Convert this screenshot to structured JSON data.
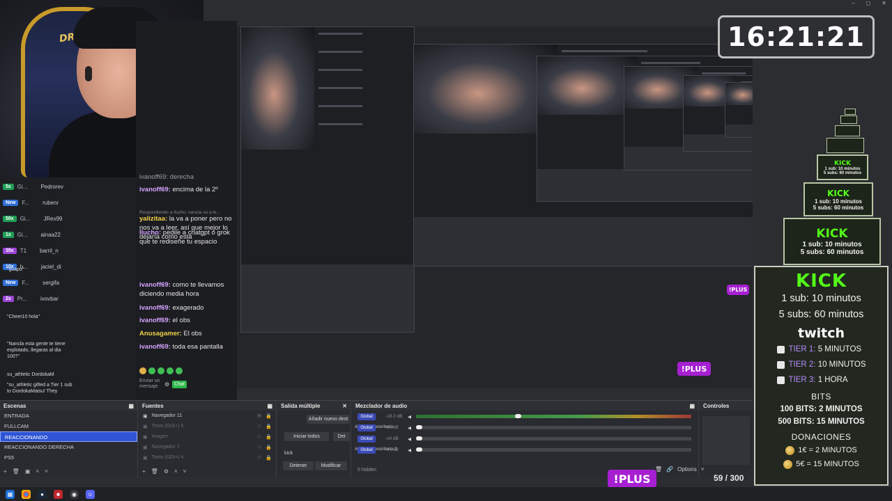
{
  "clock": {
    "time": "16:21:21"
  },
  "cam": {
    "chair_text": "DRIFT"
  },
  "chat_users": [
    {
      "badge": "5x",
      "badge_label": "Gi...",
      "name": "Pedrorev",
      "color": "#1f9d55"
    },
    {
      "badge": "New",
      "badge_label": "F...",
      "name": "rubenr",
      "color": "#2f6fd6"
    },
    {
      "badge": "50x",
      "badge_label": "Gi...",
      "name": "JRex99",
      "color": "#1f9d55"
    },
    {
      "badge": "1x",
      "badge_label": "Gi...",
      "name": "ainaa22",
      "color": "#1f9d55"
    },
    {
      "badge": "35x",
      "badge_label": "T1",
      "name": "barril_n",
      "color": "#9c45d6"
    },
    {
      "badge": "10x",
      "badge_label": "b...",
      "name": "jaciel_di",
      "color": "#2f6fd6"
    },
    {
      "badge": "New",
      "badge_label": "F...",
      "name": "sergifa",
      "color": "#2f6fd6"
    },
    {
      "badge": "2x",
      "badge_label": "Pr...",
      "name": "ivovbar",
      "color": "#9c45d6"
    }
  ],
  "chat_quotes": {
    "guapo": "\"guapo\"",
    "cheer": "\"Cheer10 hola\"",
    "nancla": "\"Nancla esta gente te tiene explotado, llegaras al dia 100?\"",
    "gifted_user": "su_athletic DordokaM",
    "gifted": "\"su_athletic gifted a Tier 1 sub to DordokaMaisu! They"
  },
  "messages": [
    {
      "user": "ivanoff69:",
      "text": " encima de la 2º",
      "cls": "u"
    },
    {
      "user": "yalizitaa:",
      "text": " la va a poner pero no nos va a leer, así que mejor lo dejaría como está",
      "cls": "u2"
    },
    {
      "user": "Ilucho:",
      "text": " pedile a chatgpt o grok que te rediseñe tu espacio",
      "cls": "u"
    },
    {
      "user": "ivanoff69:",
      "text": " como te llevamos diciendo media hora",
      "cls": "u"
    },
    {
      "user": "ivanoff69:",
      "text": " exagerado",
      "cls": "u"
    },
    {
      "user": "ivanoff69:",
      "text": " el obs",
      "cls": "u"
    },
    {
      "user": "Anusagamer:",
      "text": " El obs",
      "cls": "u2"
    },
    {
      "user": "ivanoff69:",
      "text": " toda esa pantalla",
      "cls": "u"
    }
  ],
  "reply_hint": "Respondiendo a Ilucho: nancla va a te...",
  "top_partial": "ivanoff69: derecha",
  "send_button": "Chat",
  "chat_input_placeholder": "Enviar un mensaje",
  "obs": {
    "scenes": {
      "title": "Escenas",
      "items": [
        "ENTRADA",
        "FULLCAM",
        "REACCIONANDO",
        "REACCIONANDO DERECHA",
        "PS5"
      ],
      "selected_index": 2
    },
    "sources": {
      "title": "Fuentes",
      "items": [
        {
          "name": "Navegador 11",
          "dim": false
        },
        {
          "name": "Texto (GDI+) 5",
          "dim": true
        },
        {
          "name": "Imagen",
          "dim": true
        },
        {
          "name": "Navegador 7",
          "dim": true
        },
        {
          "name": "Texto (GDI+) 4",
          "dim": true
        }
      ]
    },
    "multi_output": {
      "title": "Salida múltiple",
      "add_button": "Añadir nuevo dest",
      "start_all": "Iniciar todos",
      "dest_short": "Det",
      "target": "kick",
      "stop": "Detener",
      "modify": "Modificar"
    },
    "mixer": {
      "title": "Mezclador de audio",
      "global_label": "Global",
      "tracks": [
        {
          "label": "Audio del escritorio",
          "db": "-18.0 dB",
          "level": 0.66,
          "knob": 0.36
        },
        {
          "label": "",
          "db": "-inf dB",
          "level": 0.0,
          "knob": 0.0
        },
        {
          "label": "Audio del escritorio 2",
          "db": "-inf dB",
          "level": 0.0,
          "knob": 0.0
        },
        {
          "label": "",
          "db": "-inf dB",
          "level": 0.0,
          "knob": 0.0
        }
      ],
      "hidden": "0 hidden"
    },
    "controls": {
      "title": "Controles"
    },
    "options": "Options"
  },
  "kick_mini": [
    {
      "sub1": "1 sub: 10 minutos",
      "sub5": "5 subs: 60 minutos"
    },
    {
      "sub1": "1 sub: 10 minutos",
      "sub5": "5 subs: 60 minutos"
    },
    {
      "sub1": "1 sub: 10 minutos",
      "sub5": "5 subs: 60 minutos"
    }
  ],
  "panel": {
    "kick_logo": "KICK",
    "kick_sub1": "1 sub: 10 minutos",
    "kick_sub5": "5 subs: 60 minutos",
    "twitch_logo": "twitch",
    "tiers": [
      {
        "name": "TIER 1:",
        "value": "5 MINUTOS"
      },
      {
        "name": "TIER 2:",
        "value": "10 MINUTOS"
      },
      {
        "name": "TIER 3:",
        "value": "1 HORA"
      }
    ],
    "bits_title": "BITS",
    "bits": [
      "100 BITS: 2 MINUTOS",
      "500 BITS: 15 MINUTOS"
    ],
    "donations_title": "DONACIONES",
    "donations": [
      "1€ = 2 MINUTOS",
      "5€ = 15 MINUTOS"
    ]
  },
  "plus_label": "!PLUS",
  "counter": "59 / 300",
  "colors": {
    "accent_kick": "#53fc18",
    "scene_selected": "#2f55d4",
    "plus": "#a61fd1"
  }
}
